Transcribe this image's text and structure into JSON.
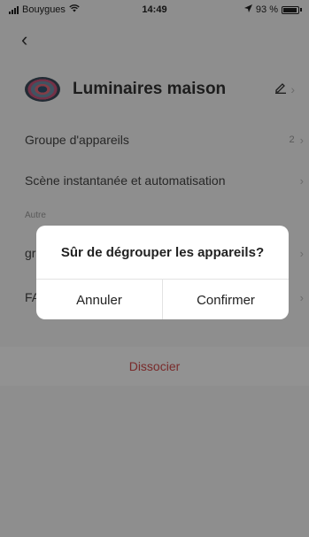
{
  "status": {
    "carrier": "Bouygues",
    "time": "14:49",
    "battery": "93 %"
  },
  "header": {
    "title": "Luminaires maison"
  },
  "rows": [
    {
      "label": "Groupe d'appareils",
      "value": "2"
    },
    {
      "label": "Scène instantanée et automatisation"
    },
    {
      "label": "gr"
    },
    {
      "label": "FA"
    }
  ],
  "section_label": "Autre",
  "dissociate_label": "Dissocier",
  "dialog": {
    "message": "Sûr de dégrouper les appareils?",
    "cancel_label": "Annuler",
    "confirm_label": "Confirmer"
  },
  "icons": {
    "back": "chevron-left-icon",
    "edit": "edit-icon",
    "row_chevron": "chevron-right-icon",
    "wifi": "wifi-icon",
    "location": "location-arrow-icon",
    "battery": "battery-icon"
  },
  "colors": {
    "danger": "#d04a4a",
    "overlay": "rgba(0,0,0,0.42)"
  }
}
